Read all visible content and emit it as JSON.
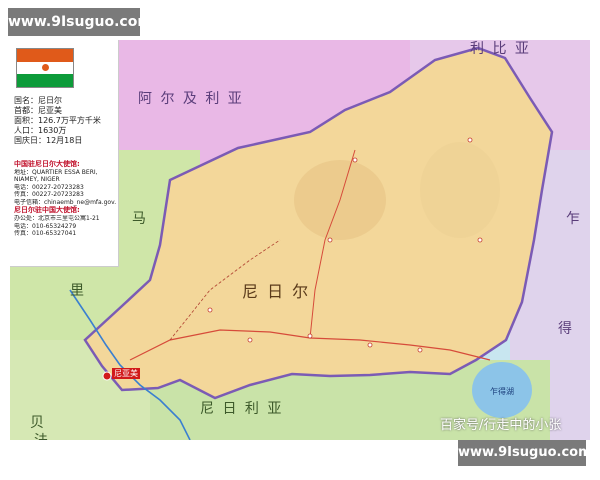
{
  "watermark": {
    "top": "www.9Isuguo.com",
    "bottom": "www.9Isuguo.com"
  },
  "info": {
    "name": "国名：尼日尔",
    "capital": "首都：尼亚美",
    "area": "面积：126.7万平方千米",
    "population": "人口：1630万",
    "national_day": "国庆日：12月18日"
  },
  "embassy": {
    "head1": "中国驻尼日尔大使馆:",
    "address1": "地址：QUARTIER ESSA BERI,",
    "address1b": "NIAMEY, NIGER",
    "tel1": "电话：00227-20723283",
    "fax1": "传真：00227-20723283",
    "email1": "电子信箱：chinaemb_ne@mfa.gov.cn",
    "head2": "尼日尔驻中国大使馆:",
    "address2": "办公处：北京市三里屯公寓1-21",
    "tel2": "电话：010-65324279",
    "fax2": "传真：010-65327041"
  },
  "labels": {
    "algeria": "阿 尔 及 利 亚",
    "libya": "利 比 亚",
    "mali_1": "马",
    "mali_2": "里",
    "niger": "尼     日     尔",
    "chad_1": "乍",
    "chad_2": "得",
    "nigeria": "尼     日     利     亚",
    "benin": "贝",
    "burkina": "法",
    "niamey": "尼亚美",
    "lake": "乍得湖"
  },
  "credit": "百家号/行走中的小张",
  "colors": {
    "niger": "#f3d79a",
    "algeria": "#e9b8e6",
    "libya": "#e6c8ea",
    "mali": "#cfe6a8",
    "chad": "#dfd3ec",
    "nigeria": "#c9e3a8",
    "border": "#7b5bb5",
    "capital": "#d11a1a"
  }
}
